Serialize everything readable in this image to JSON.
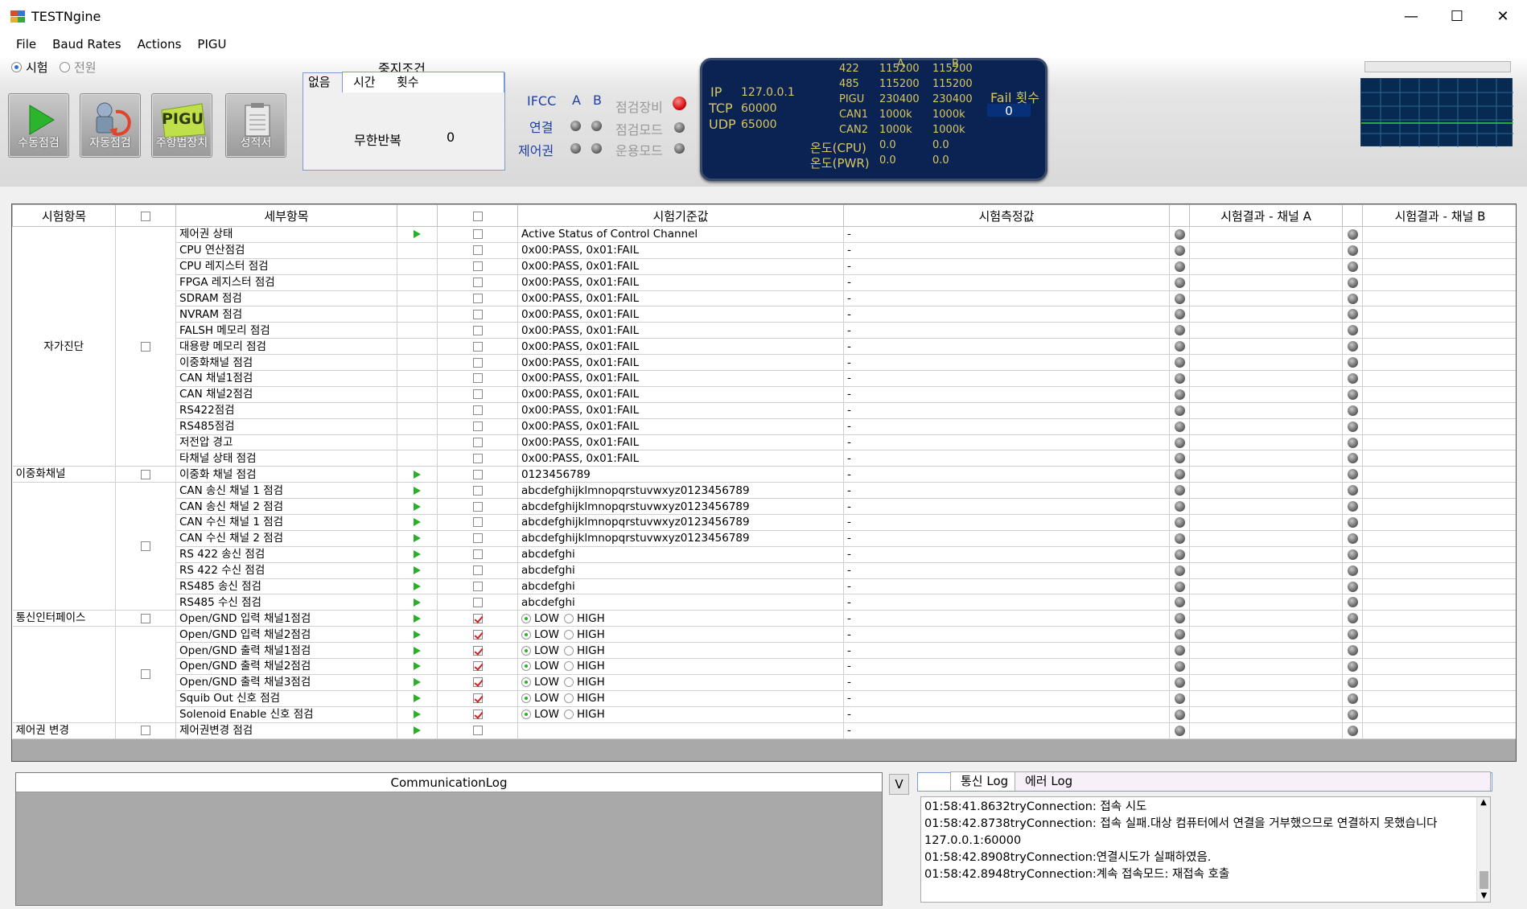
{
  "window": {
    "title": "TESTNgine",
    "minimize": "—",
    "maximize": "☐",
    "close": "✕"
  },
  "menu": [
    "File",
    "Baud Rates",
    "Actions",
    "PIGU"
  ],
  "mode": {
    "test_label": "시험",
    "power_label": "전원",
    "selected": "test"
  },
  "toolbar_buttons": [
    {
      "label": "수동점검",
      "icon": "play-icon"
    },
    {
      "label": "자동점검",
      "icon": "robot-icon"
    },
    {
      "label": "주항법장치",
      "icon": "pigu-icon"
    },
    {
      "label": "성적서",
      "icon": "report-icon"
    }
  ],
  "pigu_icon_text": "PIGU",
  "stop_condition": {
    "title": "중지조건",
    "tabs": [
      "없음",
      "시간",
      "횟수"
    ],
    "label": "무한반복",
    "value": "0"
  },
  "ifcc": {
    "title": "IFCC",
    "col_a": "A",
    "col_b": "B",
    "rows": [
      "연결",
      "제어권"
    ],
    "right_labels": [
      "점검장비",
      "점검모드",
      "운용모드"
    ]
  },
  "connection": {
    "ip_label": "IP",
    "ip": "127.0.0.1",
    "tcp_label": "TCP",
    "tcp": "60000",
    "udp_label": "UDP",
    "udp": "65000",
    "col_a": "A",
    "col_b": "B",
    "rates": [
      {
        "name": "422",
        "a": "115200",
        "b": "115200"
      },
      {
        "name": "485",
        "a": "115200",
        "b": "115200"
      },
      {
        "name": "PIGU",
        "a": "230400",
        "b": "230400"
      },
      {
        "name": "CAN1",
        "a": "1000k",
        "b": "1000k"
      },
      {
        "name": "CAN2",
        "a": "1000k",
        "b": "1000k"
      }
    ],
    "temps": [
      {
        "name": "온도(CPU)",
        "a": "0.0",
        "b": "0.0"
      },
      {
        "name": "온도(PWR)",
        "a": "0.0",
        "b": "0.0"
      }
    ],
    "fail_label": "Fail 횟수",
    "fail_count": "0"
  },
  "grid": {
    "headers": [
      "시험항목",
      "",
      "세부항목",
      "",
      "",
      "시험기준값",
      "시험측정값",
      "",
      "시험결과 - 채널 A",
      "",
      "시험결과 - 채널 B"
    ],
    "groups": [
      {
        "name": "자가진단",
        "rows": 15
      },
      {
        "name": "이중화채널",
        "rows": 1
      },
      {
        "name": "",
        "rows": 8
      },
      {
        "name": "통신인터페이스",
        "rows": 1
      },
      {
        "name": "",
        "rows": 6
      },
      {
        "name": "제어권 변경",
        "rows": 1
      }
    ],
    "rows": [
      {
        "detail": "제어권 상태",
        "play": true,
        "chk": false,
        "std": "Active Status of Control Channel",
        "meas": "-"
      },
      {
        "detail": "CPU 연산점검",
        "play": false,
        "chk": false,
        "std": "0x00:PASS,  0x01:FAIL",
        "meas": "-"
      },
      {
        "detail": "CPU 레지스터 점검",
        "play": false,
        "chk": false,
        "std": "0x00:PASS,  0x01:FAIL",
        "meas": "-"
      },
      {
        "detail": "FPGA 레지스터 점검",
        "play": false,
        "chk": false,
        "std": "0x00:PASS,  0x01:FAIL",
        "meas": "-"
      },
      {
        "detail": "SDRAM 점검",
        "play": false,
        "chk": false,
        "std": "0x00:PASS,  0x01:FAIL",
        "meas": "-"
      },
      {
        "detail": "NVRAM 점검",
        "play": false,
        "chk": false,
        "std": "0x00:PASS,  0x01:FAIL",
        "meas": "-"
      },
      {
        "detail": "FALSH 메모리 점검",
        "play": false,
        "chk": false,
        "std": "0x00:PASS,  0x01:FAIL",
        "meas": "-"
      },
      {
        "detail": "대용량 메모리 점검",
        "play": false,
        "chk": false,
        "std": "0x00:PASS,  0x01:FAIL",
        "meas": "-"
      },
      {
        "detail": "이중화채널 점검",
        "play": false,
        "chk": false,
        "std": "0x00:PASS,  0x01:FAIL",
        "meas": "-"
      },
      {
        "detail": "CAN 채널1점검",
        "play": false,
        "chk": false,
        "std": "0x00:PASS,  0x01:FAIL",
        "meas": "-"
      },
      {
        "detail": "CAN 채널2점검",
        "play": false,
        "chk": false,
        "std": "0x00:PASS,  0x01:FAIL",
        "meas": "-"
      },
      {
        "detail": "RS422점검",
        "play": false,
        "chk": false,
        "std": "0x00:PASS,  0x01:FAIL",
        "meas": "-"
      },
      {
        "detail": "RS485점검",
        "play": false,
        "chk": false,
        "std": "0x00:PASS,  0x01:FAIL",
        "meas": "-"
      },
      {
        "detail": "저전압 경고",
        "play": false,
        "chk": false,
        "std": "0x00:PASS,  0x01:FAIL",
        "meas": "-"
      },
      {
        "detail": "타채널 상태 점검",
        "play": false,
        "chk": false,
        "std": "0x00:PASS,  0x01:FAIL",
        "meas": "-"
      },
      {
        "detail": "이중화 채널 점검",
        "play": true,
        "chk": false,
        "std": "0123456789",
        "meas": "-"
      },
      {
        "detail": "CAN 송신 채널 1 점검",
        "play": true,
        "chk": false,
        "std": "abcdefghijklmnopqrstuvwxyz0123456789",
        "meas": "-"
      },
      {
        "detail": "CAN 송신 채널 2 점검",
        "play": true,
        "chk": false,
        "std": "abcdefghijklmnopqrstuvwxyz0123456789",
        "meas": "-"
      },
      {
        "detail": "CAN 수신 채널 1 점검",
        "play": true,
        "chk": false,
        "std": "abcdefghijklmnopqrstuvwxyz0123456789",
        "meas": "-"
      },
      {
        "detail": "CAN 수신 채널 2 점검",
        "play": true,
        "chk": false,
        "std": "abcdefghijklmnopqrstuvwxyz0123456789",
        "meas": "-"
      },
      {
        "detail": "RS 422 송신 점검",
        "play": true,
        "chk": false,
        "std": "abcdefghi",
        "meas": "-"
      },
      {
        "detail": "RS 422 수신 점검",
        "play": true,
        "chk": false,
        "std": "abcdefghi",
        "meas": "-"
      },
      {
        "detail": "RS485 송신 점검",
        "play": true,
        "chk": false,
        "std": "abcdefghi",
        "meas": "-"
      },
      {
        "detail": "RS485 수신 점검",
        "play": true,
        "chk": false,
        "std": "abcdefghi",
        "meas": "-"
      },
      {
        "detail": "Open/GND 입력 채널1점검",
        "play": true,
        "chk": true,
        "std": "LOWHIGH",
        "meas": "-"
      },
      {
        "detail": "Open/GND 입력 채널2점검",
        "play": true,
        "chk": true,
        "std": "LOWHIGH",
        "meas": "-"
      },
      {
        "detail": "Open/GND 출력 채널1점검",
        "play": true,
        "chk": true,
        "std": "LOWHIGH",
        "meas": "-"
      },
      {
        "detail": "Open/GND 출력 채널2점검",
        "play": true,
        "chk": true,
        "std": "LOWHIGH",
        "meas": "-"
      },
      {
        "detail": "Open/GND 출력 채널3점검",
        "play": true,
        "chk": true,
        "std": "LOWHIGH",
        "meas": "-"
      },
      {
        "detail": "Squib Out 신호 점검",
        "play": true,
        "chk": true,
        "std": "LOWHIGH",
        "meas": "-"
      },
      {
        "detail": "Solenoid Enable 신호 점검",
        "play": true,
        "chk": true,
        "std": "LOWHIGH",
        "meas": "-"
      },
      {
        "detail": "제어권변경 점검",
        "play": true,
        "chk": false,
        "std": "",
        "meas": "-"
      }
    ],
    "low_label": "LOW",
    "high_label": "HIGH"
  },
  "comm_log": {
    "title": "CommunicationLog"
  },
  "v_button": "V",
  "log_tabs": [
    "통신 Log",
    "에러 Log"
  ],
  "log_lines": [
    "01:58:41.8632tryConnection: 접속 시도",
    "01:58:42.8738tryConnection: 접속 실패.대상 컴퓨터에서 연결을 거부했으므로 연결하지 못했습니다",
    "127.0.0.1:60000",
    "01:58:42.8908tryConnection:연결시도가 실패하였음.",
    "01:58:42.8948tryConnection:계속 접속모드: 재접속 호출"
  ],
  "colors": {
    "panel_bg": "#0b2352",
    "panel_text": "#d8c75e",
    "play": "#2cae2c",
    "led_red": "#c80000"
  }
}
